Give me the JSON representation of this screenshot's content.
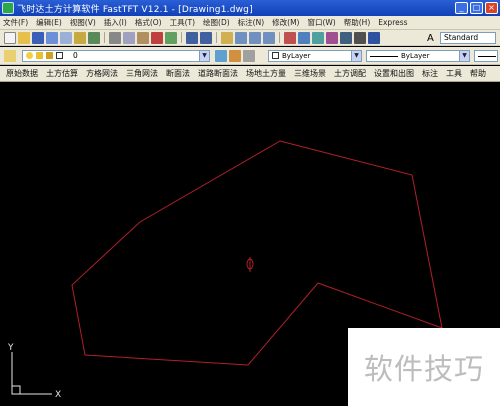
{
  "titlebar": {
    "title": "飞时达土方计算软件 FastTFT V12.1  - [Drawing1.dwg]",
    "min": "_",
    "max": "□",
    "close": "×"
  },
  "menu": [
    "文件(F)",
    "编辑(E)",
    "视图(V)",
    "插入(I)",
    "格式(O)",
    "工具(T)",
    "绘图(D)",
    "标注(N)",
    "修改(M)",
    "窗口(W)",
    "帮助(H)",
    "Express"
  ],
  "toolbar1": {
    "style_value": "Standard"
  },
  "toolbar2": {
    "layer_value": "0",
    "color_value": "ByLayer",
    "linetype_value": "ByLayer"
  },
  "commands": [
    "原始数据",
    "土方估算",
    "方格网法",
    "三角网法",
    "断面法",
    "道路断面法",
    "场地土方量",
    "三维场景",
    "土方调配",
    "设置和出图",
    "标注",
    "工具",
    "帮助"
  ],
  "canvas": {
    "ucs_x": "X",
    "ucs_y": "Y",
    "polygon_color": "#b0202a"
  },
  "watermark": {
    "text": "软件技巧"
  }
}
